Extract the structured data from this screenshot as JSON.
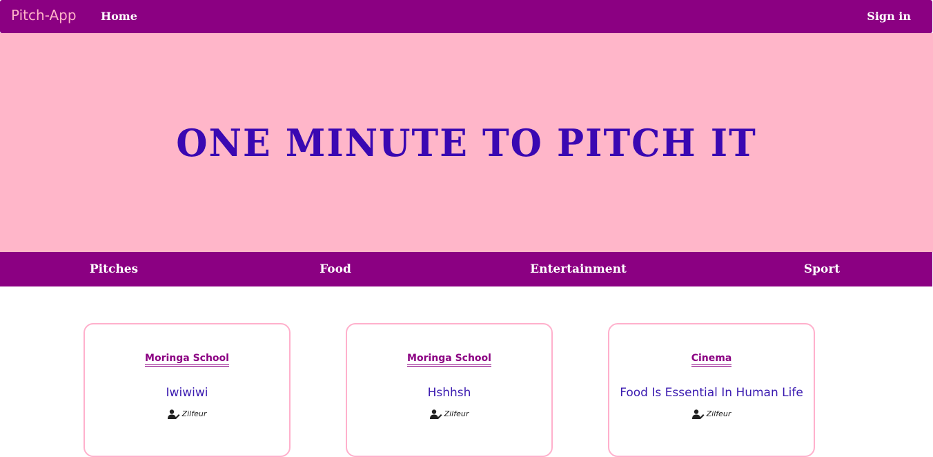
{
  "navbar": {
    "brand": "Pitch-App",
    "home": "Home",
    "sign_in": "Sign in"
  },
  "hero": {
    "title": "ONE MINUTE TO PITCH IT"
  },
  "categories": [
    "Pitches",
    "Food",
    "Entertainment",
    "Sport"
  ],
  "cards": [
    {
      "category": "Moringa School",
      "title": "Iwiwiwi",
      "author": "Zilfeur",
      "author_icon": "user-pen-icon"
    },
    {
      "category": "Moringa School",
      "title": "Hshhsh",
      "author": "Zilfeur",
      "author_icon": "user-pen-icon"
    },
    {
      "category": "Cinema",
      "title": "Food Is Essential In Human Life",
      "author": "Zilfeur",
      "author_icon": "user-pen-icon"
    }
  ],
  "colors": {
    "primary": "#8b0082",
    "hero_bg": "#ffb6c9",
    "hero_text": "#3a08b2",
    "brand_text": "#ffb3c8",
    "card_border": "#ffb0cc"
  }
}
